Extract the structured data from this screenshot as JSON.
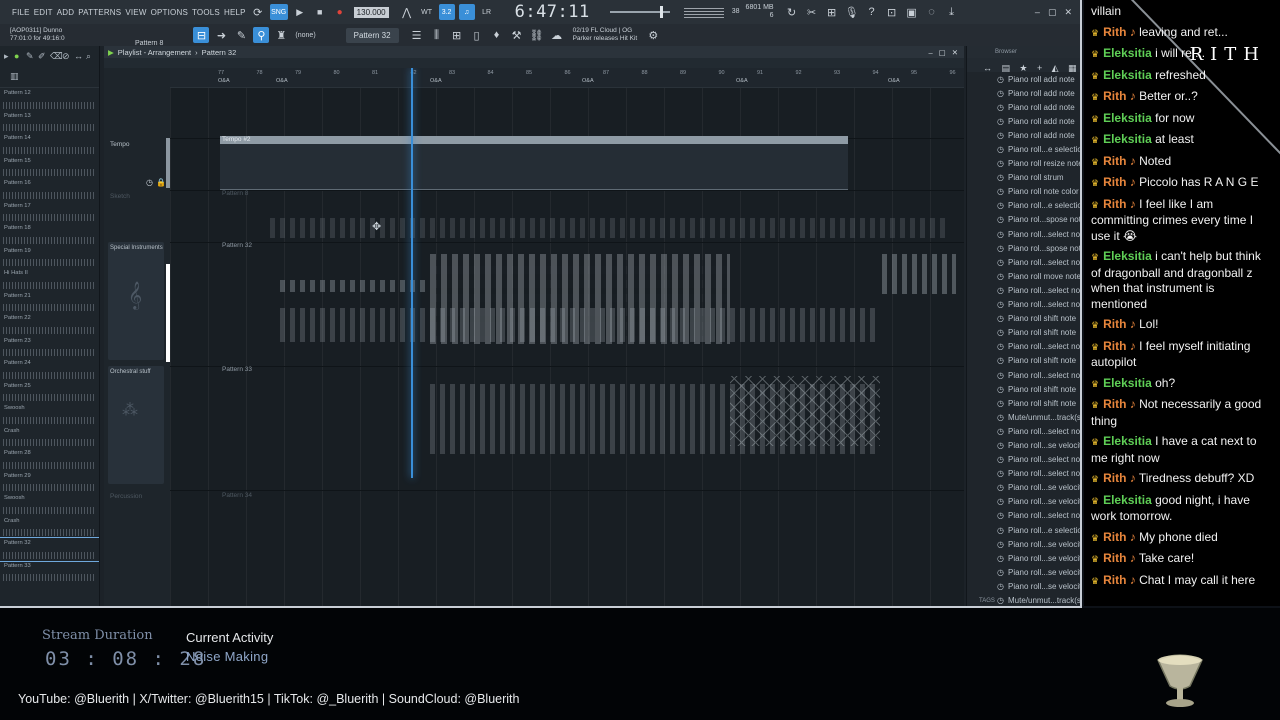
{
  "daw": {
    "menus": [
      "FILE",
      "EDIT",
      "ADD",
      "PATTERNS",
      "VIEW",
      "OPTIONS",
      "TOOLS",
      "HELP"
    ],
    "tempo": "130.000",
    "clock": "6:47:11",
    "cpu_label": "CPU",
    "cpu_value": "38",
    "memory_value": "6801 MB",
    "memory_sub": "6",
    "project_line1": "[AOP0311] Dunno",
    "project_line2": "77:01:0 for 49:16:0",
    "pattern_small": "Pattern 8",
    "pattern_selector": "Pattern 32",
    "snap": "(none)",
    "news_line1": "02/19  FL Cloud | OG",
    "news_line2": "Parker releases Hit Kit",
    "playlist_title": "Playlist - Arrangement",
    "playlist_pattern": "Pattern 32",
    "ruler_numbers": [
      "77",
      "78",
      "79",
      "80",
      "81",
      "82",
      "83",
      "84",
      "85",
      "86",
      "87",
      "88",
      "89",
      "90",
      "91",
      "92",
      "93",
      "94",
      "95",
      "96"
    ],
    "ruler_markers": [
      "O&A",
      "O&A",
      "O&A",
      "O&A",
      "O&A",
      "O&A"
    ],
    "tracks": [
      {
        "name": "Tempo",
        "clip": "Tempo #2"
      },
      {
        "name": "Sketch",
        "clip": "Pattern 8"
      },
      {
        "name": "Special Instruments",
        "clip": "Pattern 32"
      },
      {
        "name": "Orchestral stuff",
        "clip": "Pattern 33"
      },
      {
        "name": "Percussion",
        "clip": "Pattern 34"
      }
    ],
    "picker_items": [
      "Pattern 12",
      "Pattern 13",
      "Pattern 14",
      "Pattern 15",
      "Pattern 16",
      "Pattern 17",
      "Pattern 18",
      "Pattern 19",
      "Hi Hats II",
      "Pattern 21",
      "Pattern 22",
      "Pattern 23",
      "Pattern 24",
      "Pattern 25",
      "Swoosh",
      "Crash",
      "Pattern 28",
      "Pattern 29",
      "Swoosh",
      "Crash",
      "Pattern 32",
      "Pattern 33"
    ],
    "browser_title": "Browser",
    "browser_tags": "TAGS",
    "browser_items": [
      "Piano roll add note",
      "Piano roll add note",
      "Piano roll add note",
      "Piano roll add note",
      "Piano roll add note",
      "Piano roll...e selection",
      "Piano roll resize note",
      "Piano roll strum",
      "Piano roll note color",
      "Piano roll...e selection",
      "Piano rol...spose note",
      "Piano roll...select note",
      "Piano rol...spose note",
      "Piano roll...select note",
      "Piano roll move note",
      "Piano roll...select note",
      "Piano roll...select note",
      "Piano roll shift note",
      "Piano roll shift note",
      "Piano roll...select note",
      "Piano roll shift note",
      "Piano roll...select note",
      "Piano roll shift note",
      "Piano roll shift note",
      "Mute/unmut...track(s)",
      "Piano roll...select note",
      "Piano roll...se velocity",
      "Piano roll...select note",
      "Piano roll...select note",
      "Piano roll...se velocity",
      "Piano roll...se velocity",
      "Piano roll...select note",
      "Piano roll...e selection",
      "Piano roll...se velocity",
      "Piano roll...se velocity",
      "Piano roll...se velocity",
      "Piano roll...se velocity",
      "Mute/unmut...track(s)"
    ]
  },
  "chat": {
    "brand": "RITH",
    "messages": [
      {
        "user": "",
        "text": "villain",
        "color": "none"
      },
      {
        "user": "Rith ♪",
        "text": "leaving and ret...",
        "color": "rith"
      },
      {
        "user": "Eleksitia",
        "text": "i will ref...",
        "color": "elek"
      },
      {
        "user": "Eleksitia",
        "text": "refreshed",
        "color": "elek"
      },
      {
        "user": "Rith ♪",
        "text": "Better or..?",
        "color": "rith"
      },
      {
        "user": "Eleksitia",
        "text": "for now",
        "color": "elek"
      },
      {
        "user": "Eleksitia",
        "text": "at least",
        "color": "elek"
      },
      {
        "user": "Rith ♪",
        "text": "Noted",
        "color": "rith"
      },
      {
        "user": "Rith ♪",
        "text": "Piccolo has R A N G E",
        "color": "rith"
      },
      {
        "user": "Rith ♪",
        "text": "I feel like I am committing crimes every time I use it 😭",
        "color": "rith"
      },
      {
        "user": "Eleksitia",
        "text": "i can't help but think of dragonball and dragonball z when that instrument is mentioned",
        "color": "elek"
      },
      {
        "user": "Rith ♪",
        "text": "Lol!",
        "color": "rith"
      },
      {
        "user": "Rith ♪",
        "text": "I feel myself initiating autopilot",
        "color": "rith"
      },
      {
        "user": "Eleksitia",
        "text": "oh?",
        "color": "elek"
      },
      {
        "user": "Rith ♪",
        "text": "Not necessarily a good thing",
        "color": "rith"
      },
      {
        "user": "Eleksitia",
        "text": "I have a cat next to me right now",
        "color": "elek"
      },
      {
        "user": "Rith ♪",
        "text": "Tiredness debuff? XD",
        "color": "rith"
      },
      {
        "user": "Eleksitia",
        "text": "good night, i have work tomorrow.",
        "color": "elek"
      },
      {
        "user": "Rith ♪",
        "text": "My phone died",
        "color": "rith"
      },
      {
        "user": "Rith ♪",
        "text": "Take care!",
        "color": "rith"
      },
      {
        "user": "Rith ♪",
        "text": "Chat I may call it here",
        "color": "rith"
      }
    ]
  },
  "overlay": {
    "duration_label": "Stream Duration",
    "duration_value": "03 : 08 : 28",
    "activity_label": "Current Activity",
    "activity_value": "Noise Making",
    "socials": "YouTube: @Bluerith  |  X/Twitter: @Bluerith15  |  TikTok: @_Bluerith  |  SoundCloud: @Bluerith"
  },
  "colors": {
    "accent_blue": "#3a8fd8",
    "rith_name": "#e8863c",
    "eleksitia_name": "#5fcf56",
    "crown": "#f4c430"
  }
}
